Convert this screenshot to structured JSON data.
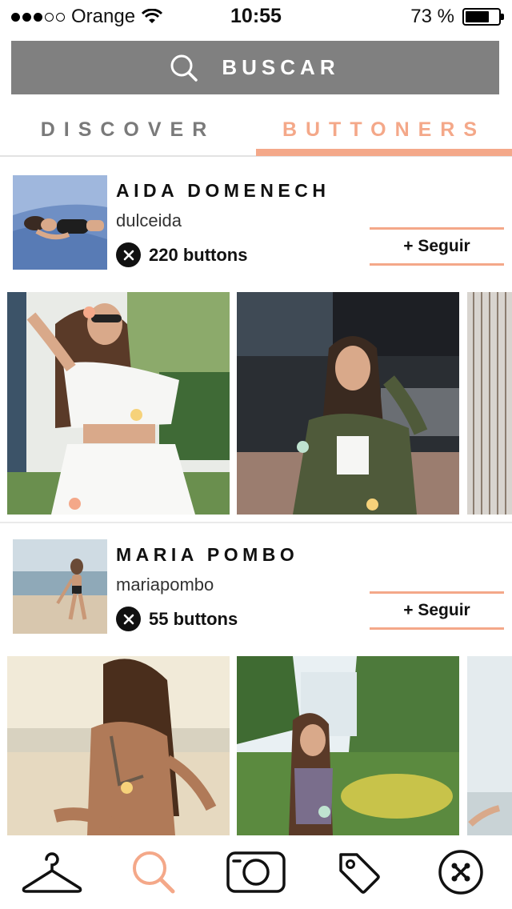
{
  "status_bar": {
    "carrier": "Orange",
    "time": "10:55",
    "battery": "73 %",
    "battery_level": 0.73
  },
  "search": {
    "label": "BUSCAR",
    "icon": "search-icon"
  },
  "tabs": [
    {
      "label": "DISCOVER",
      "active": false
    },
    {
      "label": "BUTTONERS",
      "active": true
    }
  ],
  "colors": {
    "accent": "#f4a889",
    "search_bg": "#808080",
    "tag_yellow": "#f6d27a",
    "tag_mint": "#bfe3d0",
    "tag_peach": "#f4a889"
  },
  "users": [
    {
      "name": "AIDA DOMENECH",
      "handle": "dulceida",
      "buttons": "220 buttons",
      "follow_label": "+ Seguir"
    },
    {
      "name": "MARIA POMBO",
      "handle": "mariapombo",
      "buttons": "55 buttons",
      "follow_label": "+ Seguir"
    }
  ],
  "bottom_nav": [
    {
      "icon": "hanger-icon"
    },
    {
      "icon": "search-icon",
      "active": true
    },
    {
      "icon": "camera-icon"
    },
    {
      "icon": "price-tag-icon"
    },
    {
      "icon": "button-logo-icon"
    }
  ]
}
